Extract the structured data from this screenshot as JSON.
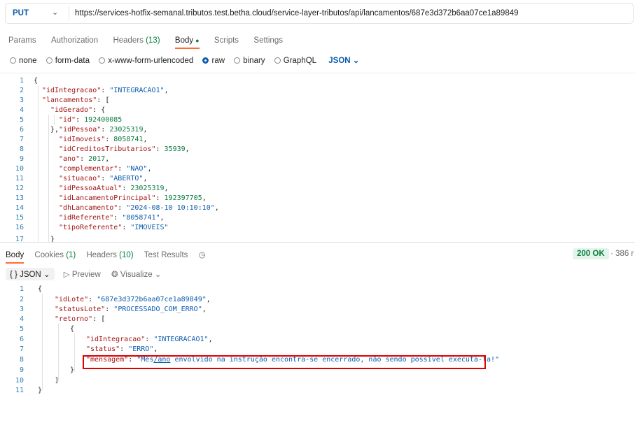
{
  "request": {
    "method": "PUT",
    "url": "https://services-hotfix-semanal.tributos.test.betha.cloud/service-layer-tributos/api/lancamentos/687e3d372b6aa07ce1a89849"
  },
  "request_tabs": {
    "params": "Params",
    "authorization": "Authorization",
    "headers": "Headers",
    "headers_count": "(13)",
    "body": "Body",
    "scripts": "Scripts",
    "settings": "Settings"
  },
  "body_options": {
    "none": "none",
    "form_data": "form-data",
    "urlencoded": "x-www-form-urlencoded",
    "raw": "raw",
    "binary": "binary",
    "graphql": "GraphQL",
    "format": "JSON"
  },
  "request_body": {
    "line_numbers": [
      "1",
      "2",
      "3",
      "4",
      "5",
      "6",
      "7",
      "8",
      "9",
      "10",
      "11",
      "12",
      "13",
      "14",
      "15",
      "16",
      "17"
    ],
    "id_integracao_key": "\"idIntegracao\"",
    "id_integracao_val": "\"INTEGRACAO1\"",
    "lancamentos_key": "\"lancamentos\"",
    "id_gerado_key": "\"idGerado\"",
    "id_key": "\"id\"",
    "id_val": "192400085",
    "id_pessoa_key": "\"idPessoa\"",
    "id_pessoa_val": "23025319",
    "id_imoveis_key": "\"idImoveis\"",
    "id_imoveis_val": "8058741",
    "id_creditos_key": "\"idCreditosTributarios\"",
    "id_creditos_val": "35939",
    "ano_key": "\"ano\"",
    "ano_val": "2017",
    "complementar_key": "\"complementar\"",
    "complementar_val": "\"NAO\"",
    "situacao_key": "\"situacao\"",
    "situacao_val": "\"ABERTO\"",
    "id_pessoa_atual_key": "\"idPessoaAtual\"",
    "id_pessoa_atual_val": "23025319",
    "id_lanc_principal_key": "\"idLancamentoPrincipal\"",
    "id_lanc_principal_val": "192397705",
    "dh_lancamento_key": "\"dhLancamento\"",
    "dh_lancamento_val": "\"2024-08-10 10:10:10\"",
    "id_referente_key": "\"idReferente\"",
    "id_referente_val": "\"8058741\"",
    "tipo_referente_key": "\"tipoReferente\"",
    "tipo_referente_val": "\"IMOVEIS\""
  },
  "response_tabs": {
    "body": "Body",
    "cookies": "Cookies",
    "cookies_count": "(1)",
    "headers": "Headers",
    "headers_count": "(10)",
    "test_results": "Test Results",
    "history_icon": "clock-icon"
  },
  "response_status": {
    "code": "200 OK",
    "size": "386 r"
  },
  "response_toolbar": {
    "format": "{ } JSON",
    "preview": "Preview",
    "visualize": "Visualize"
  },
  "response_body": {
    "line_numbers": [
      "1",
      "2",
      "3",
      "4",
      "5",
      "6",
      "7",
      "8",
      "9",
      "10",
      "11"
    ],
    "id_lote_key": "\"idLote\"",
    "id_lote_val": "\"687e3d372b6aa07ce1a89849\"",
    "status_lote_key": "\"statusLote\"",
    "status_lote_val": "\"PROCESSADO_COM_ERRO\"",
    "retorno_key": "\"retorno\"",
    "id_integracao_key": "\"idIntegracao\"",
    "id_integracao_val": "\"INTEGRACAO1\"",
    "status_key": "\"status\"",
    "status_val": "\"ERRO\"",
    "mensagem_key": "\"mensagem\"",
    "mensagem_val_a": "\"Mês",
    "mensagem_val_b": "/ano",
    "mensagem_val_c": " envolvido na instrução encontra-se encerrado, não sendo possível executá-la!\""
  },
  "colors": {
    "accent": "#ff6c37",
    "method": "#0b5cad",
    "status_ok": "#0a7f3f",
    "highlight_box": "#e00000"
  }
}
